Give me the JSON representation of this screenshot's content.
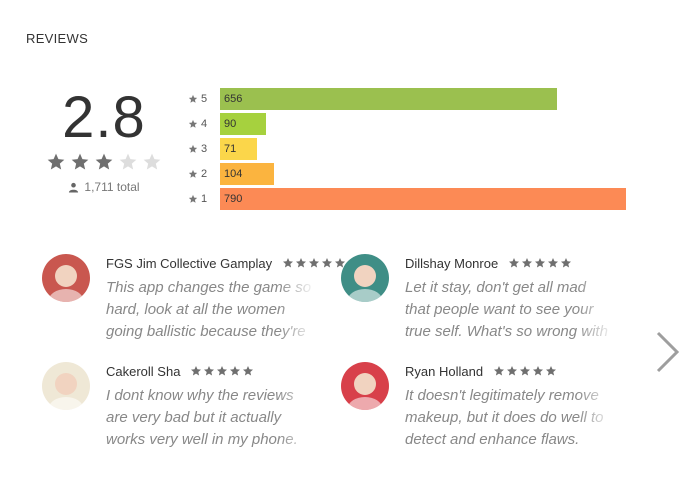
{
  "section": {
    "title": "REVIEWS"
  },
  "summary": {
    "score": "2.8",
    "stars_filled": 3,
    "stars_total": 5,
    "total_label": "1,711 total",
    "user_icon": "person-icon"
  },
  "histogram": [
    {
      "label": "5",
      "count": "656",
      "fraction": 0.831,
      "color": "#9bc04f"
    },
    {
      "label": "4",
      "count": "90",
      "fraction": 0.114,
      "color": "#a6d13e"
    },
    {
      "label": "3",
      "count": "71",
      "fraction": 0.09,
      "color": "#fbd64a"
    },
    {
      "label": "2",
      "count": "104",
      "fraction": 0.132,
      "color": "#fbb43f"
    },
    {
      "label": "1",
      "count": "790",
      "fraction": 1.0,
      "color": "#fc8a55"
    }
  ],
  "reviews": [
    {
      "author": "FGS Jim Collective Gamplay",
      "rating": 5,
      "text": "This app changes the game so hard, look at all the women going ballistic because they're",
      "avatar": {
        "icon": "avatar-anime-character",
        "bg": "#c9574f"
      }
    },
    {
      "author": "Dillshay Monroe",
      "rating": 5,
      "text": "Let it stay, don't get all mad that people want to see your true self. What's so wrong with your",
      "avatar": {
        "icon": "avatar-child-photo",
        "bg": "#3f8e86"
      }
    },
    {
      "author": "Cakeroll Sha",
      "rating": 5,
      "text": "I dont know why the reviews are very bad but it actually works very well in my phone.",
      "avatar": {
        "icon": "avatar-drawing",
        "bg": "#efe8d6"
      }
    },
    {
      "author": "Ryan Holland",
      "rating": 5,
      "text": "It doesn't legitimately remove makeup, but it does do well to detect and enhance flaws.",
      "avatar": {
        "icon": "avatar-group-photo",
        "bg": "#d8404a"
      }
    }
  ],
  "nav": {
    "next_icon": "chevron-right-icon"
  }
}
